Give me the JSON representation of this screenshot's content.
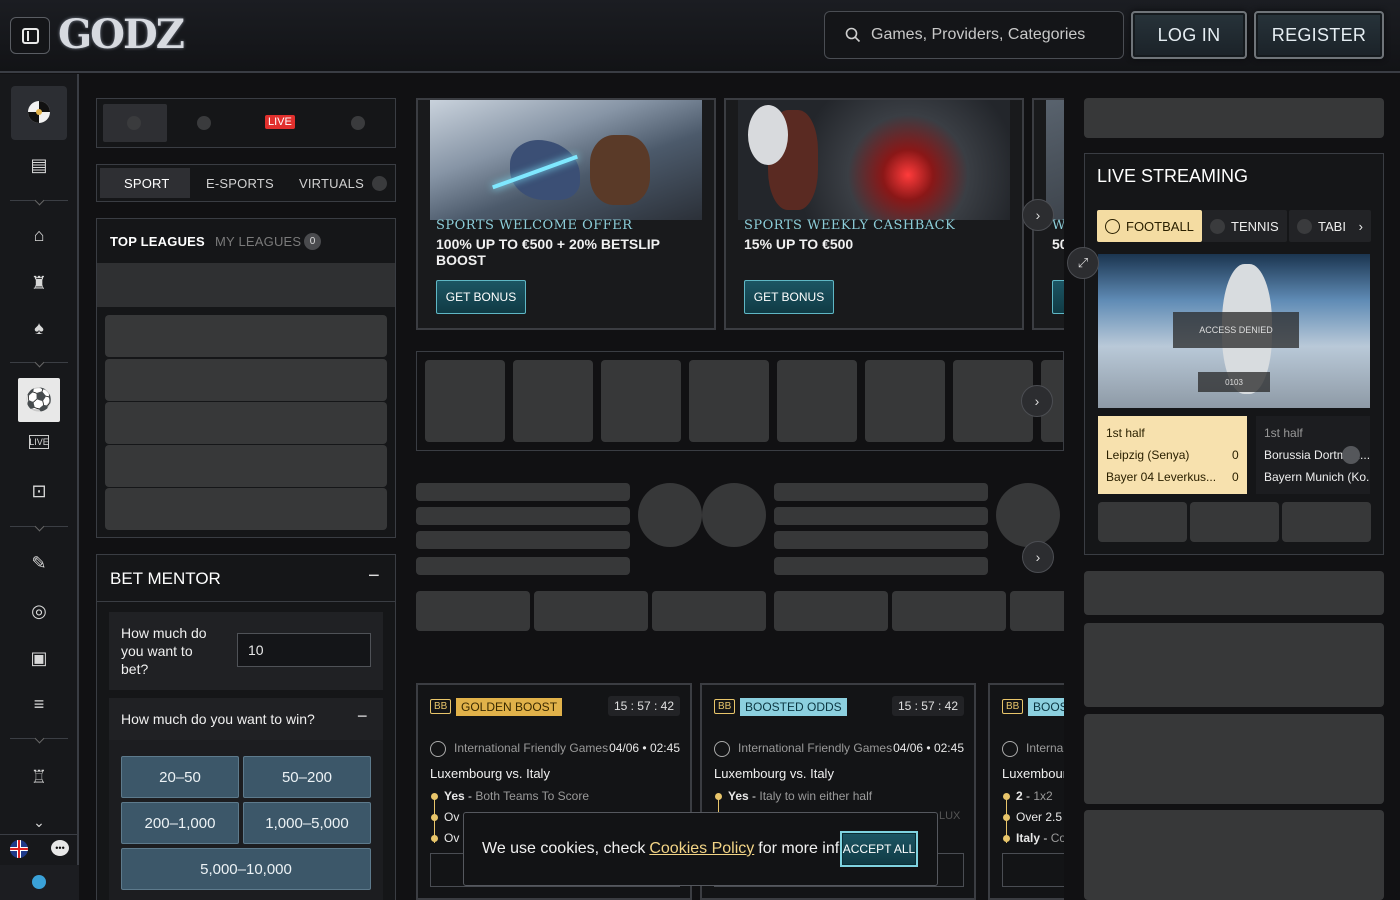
{
  "header": {
    "logo_text": "GODZ",
    "search_placeholder": "Games, Providers, Categories",
    "login_label": "LOG IN",
    "register_label": "REGISTER"
  },
  "filters": {
    "live_label": "LIVE",
    "tabs": [
      "SPORT",
      "E-SPORTS",
      "VIRTUALS"
    ],
    "active_tab": "SPORT"
  },
  "leagues": {
    "top_label": "TOP LEAGUES",
    "my_label": "MY LEAGUES",
    "my_count": "0"
  },
  "bet_mentor": {
    "title": "BET MENTOR",
    "collapse_symbol": "−",
    "bet_question": "How much do you want to bet?",
    "bet_value": "10",
    "win_question": "How much do you want to win?",
    "win_collapse_symbol": "−",
    "options": [
      "20–50",
      "50–200",
      "200–1,000",
      "1,000–5,000",
      "5,000–10,000"
    ]
  },
  "promos": [
    {
      "tag": "SPORTS WELCOME OFFER",
      "line": "100% UP TO €500 + 20% BETSLIP BOOST",
      "button": "GET BONUS"
    },
    {
      "tag": "SPORTS WEEKLY CASHBACK",
      "line": "15% UP TO €500",
      "button": "GET BONUS"
    },
    {
      "tag": "WE",
      "line": "50"
    }
  ],
  "bet_cards": [
    {
      "bb": "BB",
      "badge": "GOLDEN BOOST",
      "badge_type": "gold",
      "timer": "15 : 57 : 42",
      "league": "International Friendly Games",
      "date": "04/06 • 02:45",
      "match": "Luxembourg vs. Italy",
      "selections": [
        {
          "pick": "Yes",
          "market": "Both Teams To Score"
        },
        {
          "pick": "Ov",
          "market": ""
        },
        {
          "pick": "Ov",
          "market": ""
        }
      ]
    },
    {
      "bb": "BB",
      "badge": "BOOSTED ODDS",
      "badge_type": "blue",
      "timer": "15 : 57 : 42",
      "league": "International Friendly Games",
      "date": "04/06 • 02:45",
      "match": "Luxembourg vs. Italy",
      "selections": [
        {
          "pick": "Yes",
          "market": "Italy to win either half"
        },
        {
          "pick": "",
          "market": ""
        },
        {
          "pick": "",
          "market": ""
        }
      ]
    },
    {
      "bb": "BB",
      "badge": "BOOS",
      "badge_type": "blue",
      "timer": "",
      "league": "Interna",
      "date": "",
      "match": "Luxembourg",
      "selections": [
        {
          "pick": "2",
          "market": "1x2"
        },
        {
          "pick": "Over 2.5",
          "market": ""
        },
        {
          "pick": "Italy",
          "market": "Co"
        }
      ]
    }
  ],
  "streaming": {
    "title": "LIVE STREAMING",
    "tabs": [
      "FOOTBALL",
      "TENNIS",
      "TABI"
    ],
    "active_tab": "FOOTBALL",
    "video_overlay_1": "ACCESS DENIED",
    "video_overlay_2": "0103",
    "matches": [
      {
        "half": "1st half",
        "home": "Leipzig (Senya)",
        "away": "Bayer 04 Leverkus...",
        "home_score": "0",
        "away_score": "0"
      },
      {
        "half": "1st half",
        "home": "Borussia Dortmun...",
        "away": "Bayern Munich (Ko..."
      }
    ]
  },
  "cookie": {
    "text_before": "We use cookies, check",
    "link": "Cookies Policy",
    "text_after": "for more info.",
    "accept": "ACCEPT ALL",
    "peek_text": "LUX"
  },
  "colors": {
    "accent_teal": "#1c5563",
    "gold": "#e1b24a",
    "live_red": "#e1302d",
    "option_blue": "#3c5769"
  }
}
